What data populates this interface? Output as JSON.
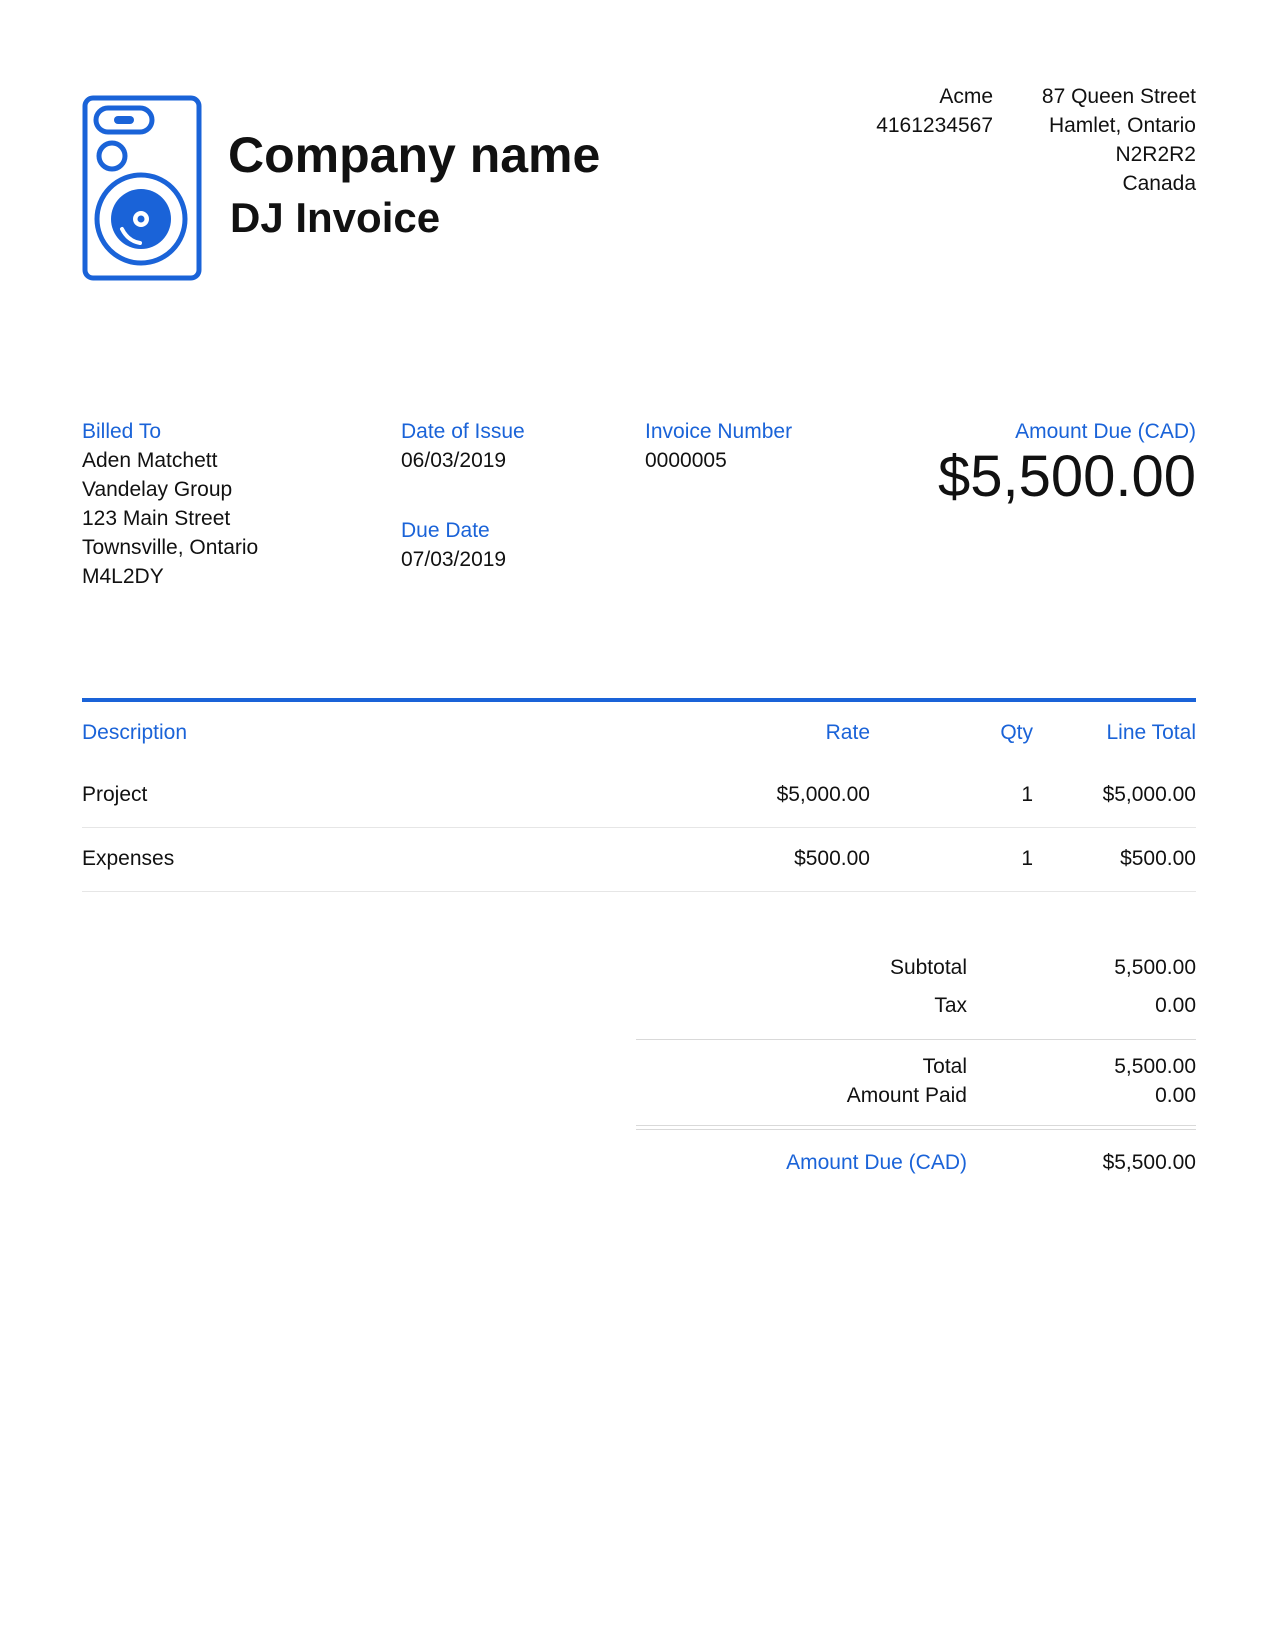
{
  "header": {
    "company_name": "Company name",
    "subtitle": "DJ Invoice",
    "logo_icon": "speaker-icon",
    "accent_color": "#1a63d8"
  },
  "sender": {
    "name": "Acme",
    "phone": "4161234567",
    "address_line1": "87 Queen Street",
    "address_line2": "Hamlet, Ontario",
    "postal_code": "N2R2R2",
    "country": "Canada"
  },
  "billed_to": {
    "label": "Billed To",
    "name": "Aden Matchett",
    "company": "Vandelay Group",
    "street": "123 Main Street",
    "city": "Townsville, Ontario",
    "postal_code": "M4L2DY"
  },
  "date_of_issue": {
    "label": "Date of Issue",
    "value": "06/03/2019"
  },
  "due_date": {
    "label": "Due Date",
    "value": "07/03/2019"
  },
  "invoice_number": {
    "label": "Invoice Number",
    "value": "0000005"
  },
  "amount_due": {
    "label": "Amount Due (CAD)",
    "value": "$5,500.00"
  },
  "table": {
    "headers": {
      "description": "Description",
      "rate": "Rate",
      "qty": "Qty",
      "line_total": "Line Total"
    },
    "rows": [
      {
        "description": "Project",
        "rate": "$5,000.00",
        "qty": "1",
        "line_total": "$5,000.00"
      },
      {
        "description": "Expenses",
        "rate": "$500.00",
        "qty": "1",
        "line_total": "$500.00"
      }
    ]
  },
  "totals": {
    "subtotal_label": "Subtotal",
    "subtotal": "5,500.00",
    "tax_label": "Tax",
    "tax": "0.00",
    "total_label": "Total",
    "total": "5,500.00",
    "amount_paid_label": "Amount Paid",
    "amount_paid": "0.00",
    "amount_due_label": "Amount Due (CAD)",
    "amount_due": "$5,500.00"
  }
}
